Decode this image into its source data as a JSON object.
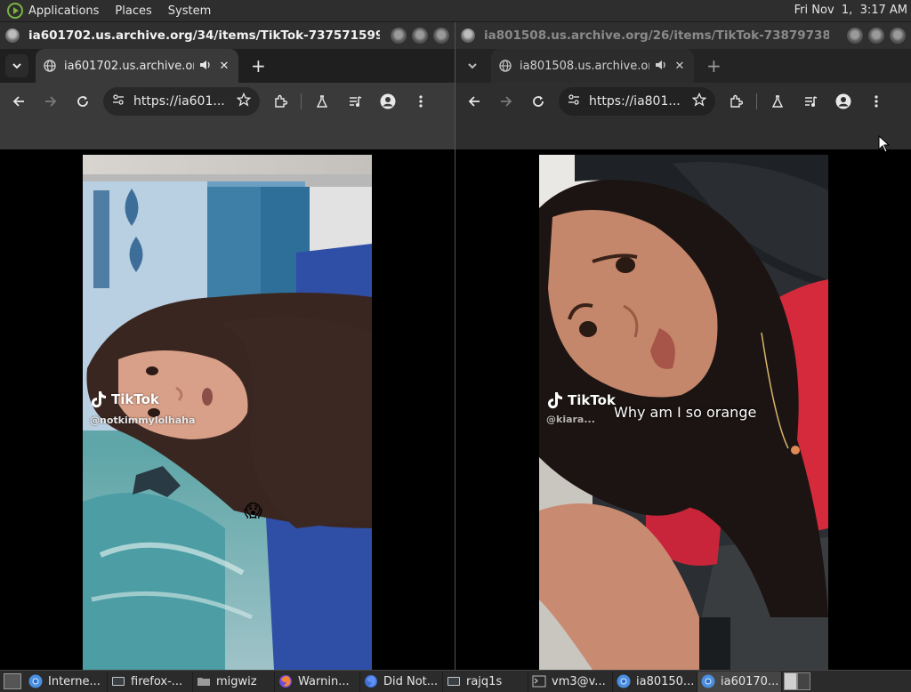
{
  "top_panel": {
    "menus": [
      "Applications",
      "Places",
      "System"
    ],
    "clock": "Fri Nov  1,  3:17 AM"
  },
  "windows": [
    {
      "id": "left",
      "title": "ia601702.us.archive.org/34/items/TikTok-737571599941430...",
      "tab_title": "ia601702.us.archive.org/3",
      "url": "https://ia601...",
      "video": {
        "brand": "TikTok",
        "handle": "@notkimmylolhaha",
        "emoji": "😱"
      }
    },
    {
      "id": "right",
      "title": "ia801508.us.archive.org/26/items/TikTok-738797383789324...",
      "tab_title": "ia801508.us.archive.org/",
      "url": "https://ia801...",
      "video": {
        "brand": "TikTok",
        "handle": "@kiara...",
        "caption": "Why am I so orange"
      }
    }
  ],
  "taskbar": {
    "items": [
      {
        "label": "Interne...",
        "icon": "chrome-icon"
      },
      {
        "label": "firefox-...",
        "icon": "terminal-icon"
      },
      {
        "label": "migwiz",
        "icon": "folder-icon"
      },
      {
        "label": "Warnin...",
        "icon": "firefox-icon"
      },
      {
        "label": "Did Not...",
        "icon": "firefox-icon"
      },
      {
        "label": "rajq1s",
        "icon": "terminal-icon"
      },
      {
        "label": "vm3@v...",
        "icon": "terminal-icon"
      },
      {
        "label": "ia80150...",
        "icon": "chrome-icon"
      },
      {
        "label": "ia60170...",
        "icon": "chrome-icon"
      }
    ]
  },
  "colors": {
    "panel": "#2e2e2e",
    "tabstrip": "#1f1f1f",
    "toolbar": "#3a3a3a",
    "accent_green": "#7cb342"
  }
}
